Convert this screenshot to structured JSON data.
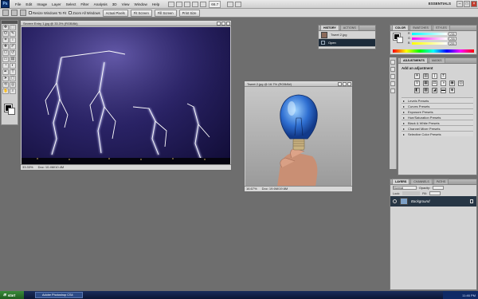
{
  "menubar": {
    "app_logo": "Ps",
    "items": [
      "File",
      "Edit",
      "Image",
      "Layer",
      "Select",
      "Filter",
      "Analysis",
      "3D",
      "View",
      "Window",
      "Help"
    ],
    "zoom": "66.7",
    "workspace": "ESSENTIALS"
  },
  "optionsbar": {
    "checkboxes": [
      "Resize Windows To Fit",
      "Zoom All Windows"
    ],
    "buttons": [
      "Actual Pixels",
      "Fit Screen",
      "Fill Screen",
      "Print Size"
    ]
  },
  "doc_storm": {
    "title": "Severe Entry 1.jpg @ 33.3% (RGB/8#)",
    "zoom": "33.33%",
    "doc_info": "Doc: 10.4M/10.4M"
  },
  "doc_bulb": {
    "title": "Tweet 2.jpg @ 16.7% (RGB/8#)",
    "zoom": "16.67%",
    "doc_info": "Doc: 19.6M/19.6M"
  },
  "history_panel": {
    "tabs": [
      "HISTORY",
      "ACTIONS"
    ],
    "items": [
      {
        "label": "Tweet 2.jpg"
      },
      {
        "label": "Open"
      }
    ]
  },
  "color_panel": {
    "tabs": [
      "COLOR",
      "SWATCHES",
      "STYLES"
    ],
    "sliders": [
      {
        "label": "R",
        "value": "255"
      },
      {
        "label": "G",
        "value": "255"
      },
      {
        "label": "B",
        "value": "255"
      }
    ]
  },
  "adjustments_panel": {
    "tabs": [
      "ADJUSTMENTS",
      "MASKS"
    ],
    "title": "Add an adjustment",
    "presets": [
      "Levels Presets",
      "Curves Presets",
      "Exposure Presets",
      "Hue/Saturation Presets",
      "Black & White Presets",
      "Channel Mixer Presets",
      "Selective Color Presets"
    ]
  },
  "layers_panel": {
    "tabs": [
      "LAYERS",
      "CHANNELS",
      "PATHS"
    ],
    "blend_mode": "Normal",
    "opacity_label": "Opacity:",
    "fill_label": "Fill:",
    "lock_label": "Lock:",
    "layers": [
      {
        "name": "Background"
      }
    ]
  },
  "taskbar": {
    "start": "start",
    "item": "Adobe Photoshop CS4",
    "clock": "11:46 PM"
  },
  "colors": {
    "workspace_bg": "#6e6e6e",
    "selected_row": "#1c2b3a",
    "taskbar": "#0b1634"
  }
}
